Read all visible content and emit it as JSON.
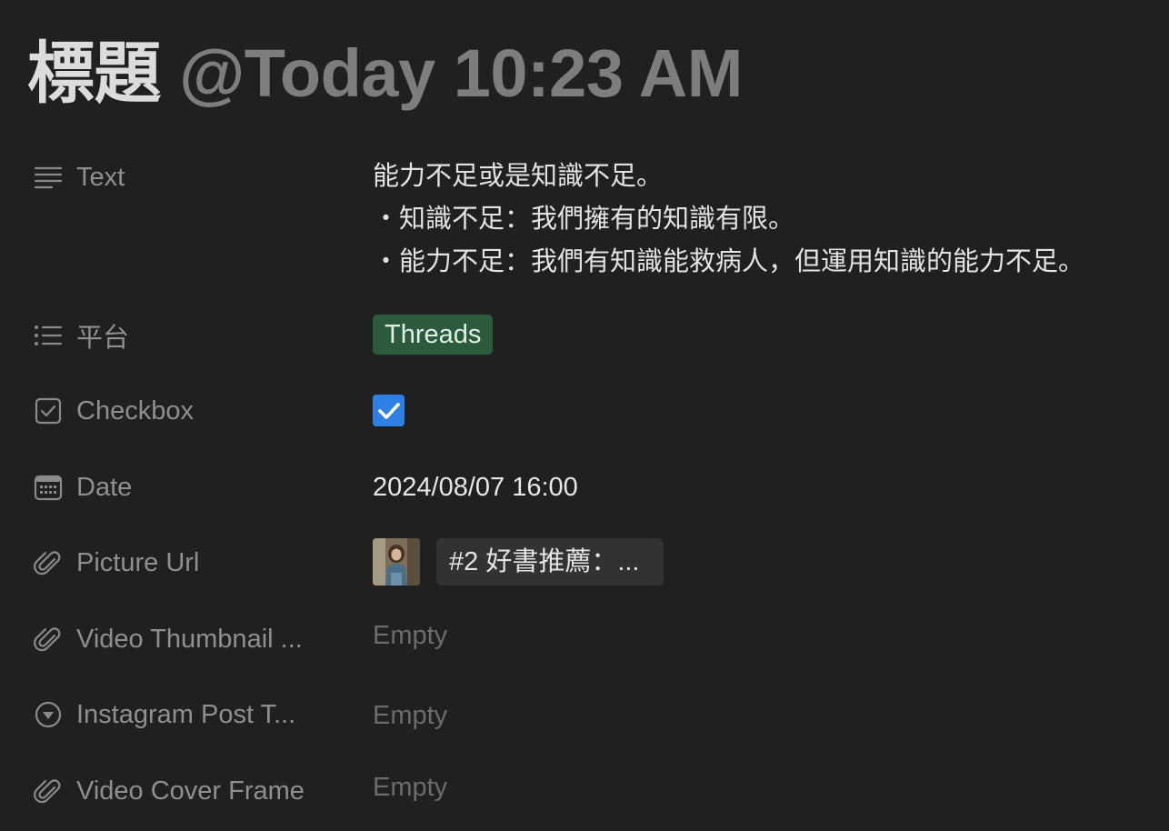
{
  "page": {
    "title": "標題",
    "mention": "@Today 10:23 AM"
  },
  "properties": {
    "text": {
      "label": "Text",
      "icon": "text-lines-icon",
      "lines": [
        "能力不足或是知識不足。",
        "・知識不足：我們擁有的知識有限。",
        "・能力不足：我們有知識能救病人，但運用知識的能力不足。"
      ]
    },
    "platform": {
      "label": "平台",
      "icon": "bulleted-list-icon",
      "tag": "Threads",
      "tag_color": "#2b5a3d"
    },
    "checkbox": {
      "label": "Checkbox",
      "icon": "checkbox-icon",
      "checked": true,
      "accent": "#2f80e4"
    },
    "date": {
      "label": "Date",
      "icon": "calendar-icon",
      "value": "2024/08/07 16:00"
    },
    "picture_url": {
      "label": "Picture Url",
      "icon": "paperclip-icon",
      "file_name": "#2 好書推薦：..."
    },
    "video_thumbnail": {
      "label": "Video Thumbnail ...",
      "icon": "paperclip-icon",
      "value": "Empty"
    },
    "instagram_post_type": {
      "label": "Instagram Post T...",
      "icon": "circle-chevron-down-icon",
      "value": "Empty"
    },
    "video_cover_frame": {
      "label": "Video Cover Frame",
      "icon": "paperclip-icon",
      "value": "Empty"
    }
  }
}
